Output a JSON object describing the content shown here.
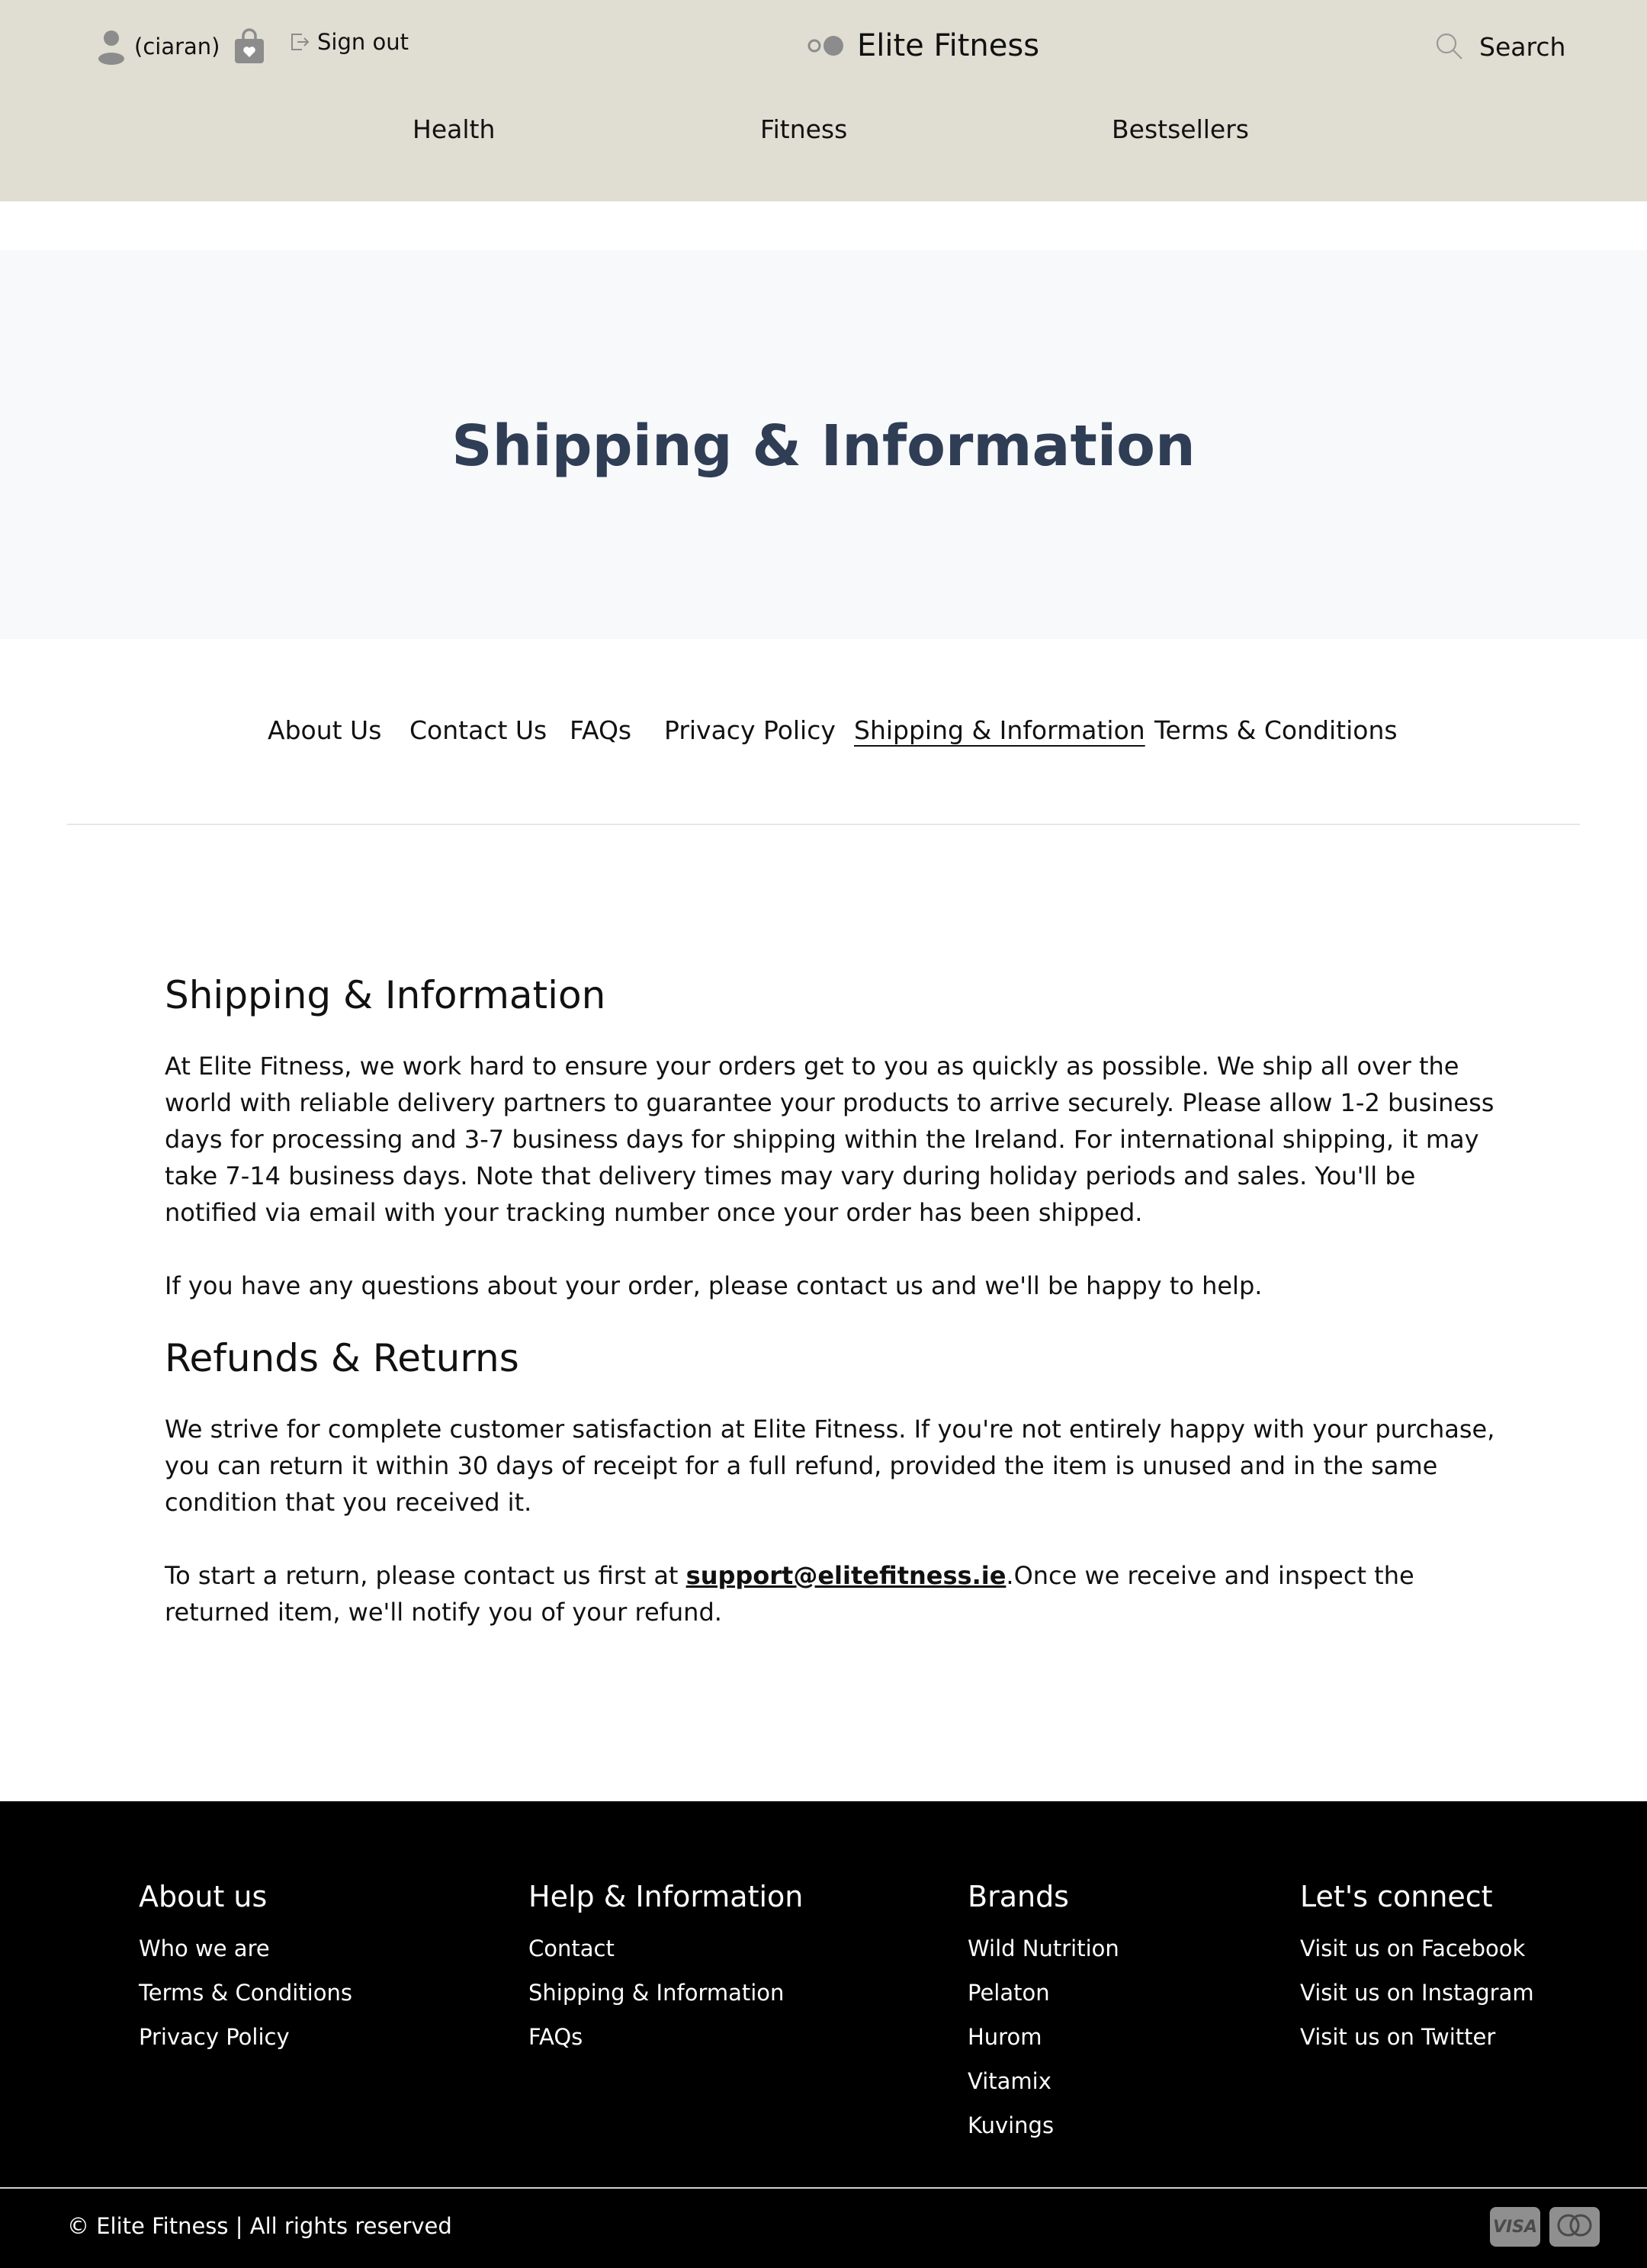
{
  "header": {
    "username": "(ciaran)",
    "signout_label": "Sign out",
    "brand_name": "Elite Fitness",
    "search_label": "Search",
    "nav": [
      {
        "label": "Health"
      },
      {
        "label": "Fitness"
      },
      {
        "label": "Bestsellers"
      }
    ],
    "colors": {
      "background": "#e0ddd2",
      "icon": "#8c8c8c"
    }
  },
  "hero": {
    "title": "Shipping & Information",
    "colors": {
      "background": "#f8f9fb",
      "title": "#2f3d55"
    }
  },
  "sub_nav": {
    "items": [
      {
        "label": "About Us"
      },
      {
        "label": "Contact Us"
      },
      {
        "label": "FAQs"
      },
      {
        "label": "Privacy Policy"
      },
      {
        "label": "Shipping & Information",
        "active": true
      },
      {
        "label": "Terms & Conditions"
      }
    ]
  },
  "content": {
    "shipping_heading": "Shipping & Information",
    "shipping_p1": "At Elite Fitness, we work hard to ensure your orders get to you as quickly as possible. We ship all over the world with reliable delivery partners to guarantee your products to arrive securely. Please allow 1-2 business days for processing and 3-7 business days for shipping within the Ireland. For international shipping, it may take 7-14 business days. Note that delivery times may vary during holiday periods and sales. You'll be notified via email with your tracking number once your order has been shipped.",
    "shipping_p2": "If you have any questions about your order, please contact us and we'll be happy to help.",
    "refunds_heading": "Refunds & Returns",
    "refunds_p1": "We strive for complete customer satisfaction at Elite Fitness. If you're not entirely happy with your purchase, you can return it within 30 days of receipt for a full refund, provided the item is unused and in the same condition that you received it.",
    "refunds_p2_before": "To start a return, please contact us first at ",
    "refunds_email": "support@elitefitness.ie",
    "refunds_p2_after": ".Once we receive and inspect the returned item, we'll notify you of your refund."
  },
  "footer": {
    "columns": [
      {
        "heading": "About us",
        "links": [
          "Who we are",
          "Terms & Conditions",
          "Privacy Policy"
        ]
      },
      {
        "heading": "Help & Information",
        "links": [
          "Contact",
          "Shipping & Information",
          "FAQs"
        ]
      },
      {
        "heading": "Brands",
        "links": [
          "Wild Nutrition",
          "Pelaton",
          "Hurom",
          "Vitamix",
          "Kuvings"
        ]
      },
      {
        "heading": "Let's connect",
        "links": [
          "Visit us on Facebook",
          "Visit us on Instagram",
          "Visit us on Twitter"
        ]
      }
    ],
    "copyright": "© Elite Fitness | All rights reserved",
    "payment_icons": [
      "visa-icon",
      "mastercard-icon"
    ],
    "visa_label": "VISA",
    "colors": {
      "background": "#000000",
      "text": "#ffffff"
    }
  }
}
